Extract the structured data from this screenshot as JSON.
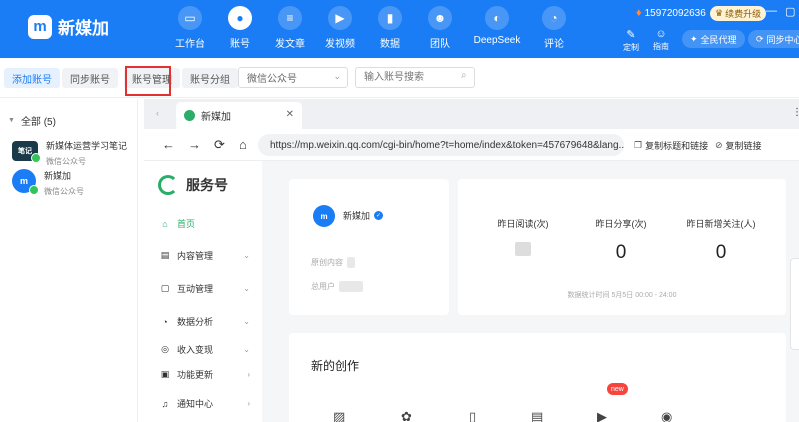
{
  "app": {
    "name": "新媒加",
    "logo_letter": "m"
  },
  "nav": [
    {
      "label": "工作台",
      "icon": "monitor-icon",
      "glyph": "▭"
    },
    {
      "label": "账号",
      "icon": "user-icon",
      "glyph": "●",
      "active": true
    },
    {
      "label": "发文章",
      "icon": "document-icon",
      "glyph": "≡"
    },
    {
      "label": "发视频",
      "icon": "video-icon",
      "glyph": "▶"
    },
    {
      "label": "数据",
      "icon": "bar-chart-icon",
      "glyph": "▮"
    },
    {
      "label": "团队",
      "icon": "team-icon",
      "glyph": "☻"
    },
    {
      "label": "DeepSeek",
      "icon": "whale-icon",
      "glyph": "◐"
    },
    {
      "label": "评论",
      "icon": "comment-icon",
      "glyph": "◔"
    }
  ],
  "top_right": {
    "phone": "15972092636",
    "upgrade": "续费升级",
    "tools": [
      {
        "label": "定制",
        "icon": "wrench-icon",
        "glyph": "✎"
      },
      {
        "label": "指南",
        "icon": "guide-icon",
        "glyph": "☺"
      }
    ],
    "pills": [
      "全民代理",
      "同步中心"
    ]
  },
  "toolbar": {
    "add": "添加账号",
    "sync": "同步账号",
    "manage": "账号管理",
    "group": "账号分组",
    "platform": "微信公众号",
    "search_placeholder": "输入账号搜索"
  },
  "accounts": {
    "group_label": "全部 (5)",
    "items": [
      {
        "name": "新媒体运营学习笔记",
        "type": "微信公众号",
        "avatar": "笔记"
      },
      {
        "name": "新媒加",
        "type": "微信公众号",
        "avatar": "m"
      }
    ]
  },
  "browser": {
    "tab_title": "新媒加",
    "url": "https://mp.weixin.qq.com/cgi-bin/home?t=home/index&token=457679648&lang...",
    "copy_title_link": "复制标题和链接",
    "copy_link": "复制链接"
  },
  "mp": {
    "service_title": "服务号",
    "menu": [
      {
        "label": "首页",
        "icon": "home-icon",
        "glyph": "⌂",
        "active": true
      },
      {
        "label": "内容管理",
        "icon": "content-icon",
        "glyph": "▤",
        "chev": "⌄"
      },
      {
        "label": "互动管理",
        "icon": "chat-icon",
        "glyph": "▢",
        "chev": "⌄"
      },
      {
        "label": "数据分析",
        "icon": "pie-icon",
        "glyph": "◔",
        "chev": "⌄"
      },
      {
        "label": "收入变现",
        "icon": "income-icon",
        "glyph": "◎",
        "chev": "⌄"
      },
      {
        "label": "功能更新",
        "icon": "update-icon",
        "glyph": "▣",
        "chev": "›"
      },
      {
        "label": "通知中心",
        "icon": "bell-icon",
        "glyph": "♫",
        "chev": "›"
      }
    ],
    "account": {
      "name": "新媒加",
      "original_label": "原创内容",
      "users_label": "总用户"
    },
    "stats": [
      {
        "label": "昨日阅读(次)",
        "value": null
      },
      {
        "label": "昨日分享(次)",
        "value": "0"
      },
      {
        "label": "昨日新增关注(人)",
        "value": "0"
      }
    ],
    "stats_note": "数据统计时间  5月5日 00:00 - 24:00",
    "new_creation": "新的创作",
    "new_badge": "new"
  },
  "colors": {
    "brand": "#1b7df5",
    "wechat_green": "#2aae67",
    "highlight_red": "#e23131"
  }
}
